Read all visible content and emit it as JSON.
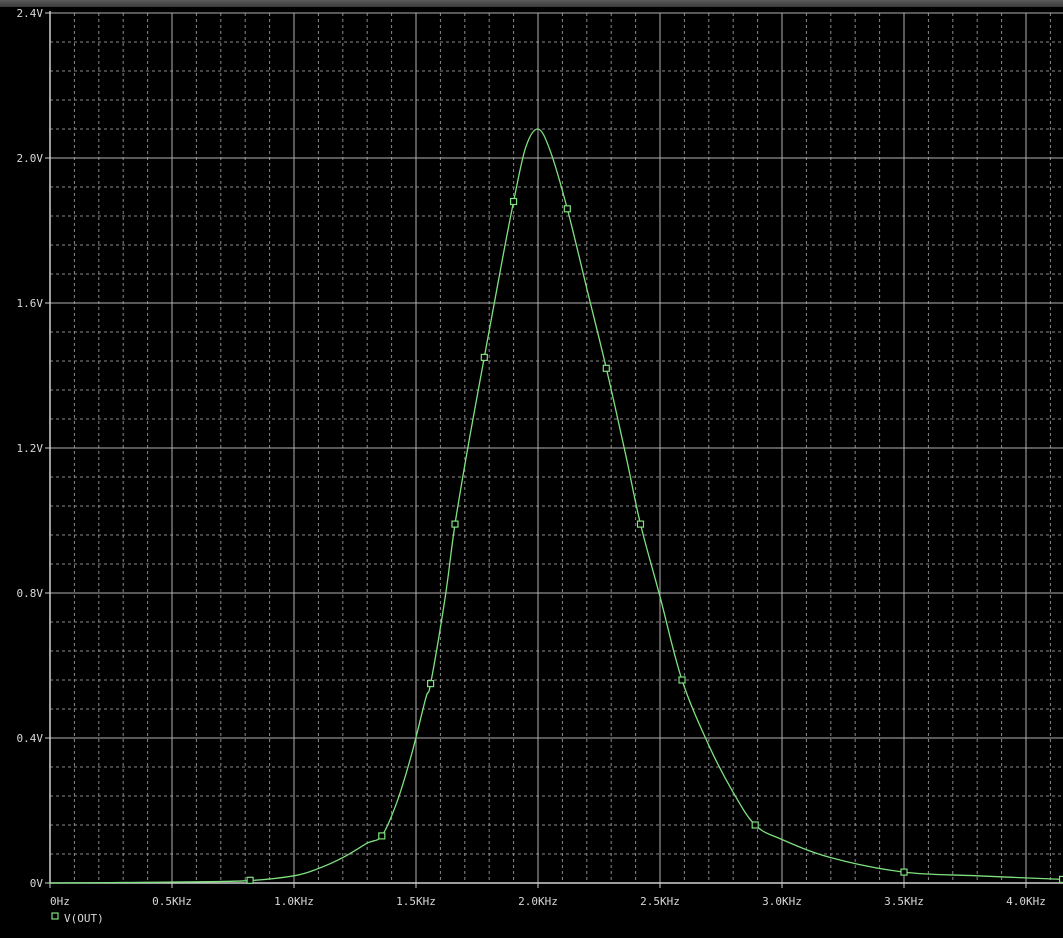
{
  "chart_data": {
    "type": "line",
    "title": "",
    "xlabel": "",
    "ylabel": "",
    "xlim": [
      0,
      4150
    ],
    "ylim": [
      0,
      2.4
    ],
    "grid": true,
    "x_ticks": [
      {
        "value": 0,
        "label": "0Hz"
      },
      {
        "value": 500,
        "label": "0.5KHz"
      },
      {
        "value": 1000,
        "label": "1.0KHz"
      },
      {
        "value": 1500,
        "label": "1.5KHz"
      },
      {
        "value": 2000,
        "label": "2.0KHz"
      },
      {
        "value": 2500,
        "label": "2.5KHz"
      },
      {
        "value": 3000,
        "label": "3.0KHz"
      },
      {
        "value": 3500,
        "label": "3.5KHz"
      },
      {
        "value": 4000,
        "label": "4.0KHz"
      }
    ],
    "y_ticks": [
      {
        "value": 0,
        "label": "0V"
      },
      {
        "value": 0.4,
        "label": "0.4V"
      },
      {
        "value": 0.8,
        "label": "0.8V"
      },
      {
        "value": 1.2,
        "label": "1.2V"
      },
      {
        "value": 1.6,
        "label": "1.6V"
      },
      {
        "value": 2.0,
        "label": "2.0V"
      },
      {
        "value": 2.4,
        "label": "2.4V"
      }
    ],
    "series": [
      {
        "name": "V(OUT)",
        "color": "#7fe07f",
        "marker": "square",
        "x": [
          0,
          400,
          800,
          1000,
          1100,
          1200,
          1300,
          1360,
          1420,
          1480,
          1540,
          1560,
          1620,
          1660,
          1720,
          1780,
          1840,
          1900,
          1950,
          2000,
          2050,
          2120,
          2200,
          2280,
          2360,
          2420,
          2500,
          2590,
          2700,
          2800,
          2890,
          3000,
          3200,
          3500,
          3800,
          4150
        ],
        "y": [
          0,
          0.002,
          0.006,
          0.02,
          0.04,
          0.07,
          0.11,
          0.13,
          0.22,
          0.35,
          0.51,
          0.55,
          0.79,
          0.99,
          1.23,
          1.45,
          1.67,
          1.88,
          2.03,
          2.08,
          2.02,
          1.86,
          1.64,
          1.42,
          1.18,
          0.99,
          0.79,
          0.56,
          0.38,
          0.25,
          0.16,
          0.12,
          0.07,
          0.03,
          0.02,
          0.01
        ]
      }
    ],
    "markers_x": [
      820,
      1360,
      1560,
      1660,
      1780,
      1900,
      2120,
      2280,
      2420,
      2590,
      2890,
      3500,
      4150
    ],
    "legend": {
      "position": "bottom-left",
      "label": "V(OUT)"
    }
  }
}
